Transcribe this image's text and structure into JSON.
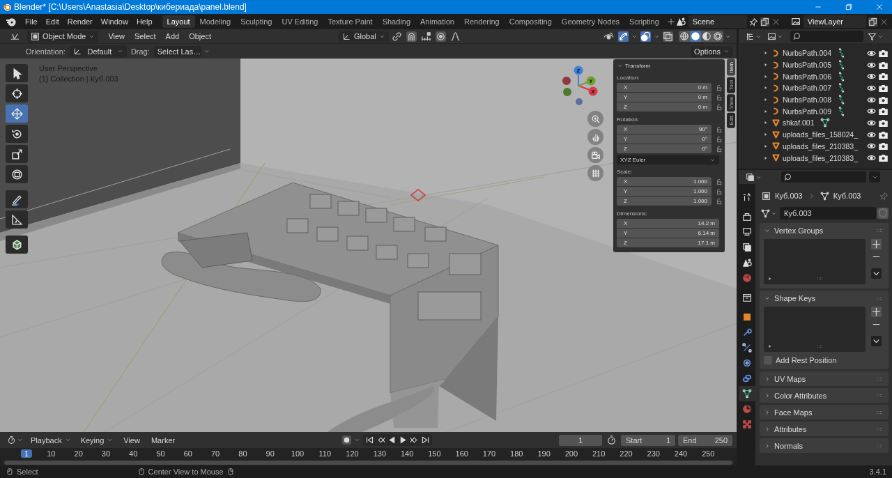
{
  "window": {
    "title": "Blender* [C:\\Users\\Anastasia\\Desktop\\кибериада\\panel.blend]"
  },
  "menu": [
    "File",
    "Edit",
    "Render",
    "Window",
    "Help"
  ],
  "workspaces": [
    {
      "label": "Layout",
      "selected": true
    },
    {
      "label": "Modeling",
      "selected": false
    },
    {
      "label": "Sculpting",
      "selected": false
    },
    {
      "label": "UV Editing",
      "selected": false
    },
    {
      "label": "Texture Paint",
      "selected": false
    },
    {
      "label": "Shading",
      "selected": false
    },
    {
      "label": "Animation",
      "selected": false
    },
    {
      "label": "Rendering",
      "selected": false
    },
    {
      "label": "Compositing",
      "selected": false
    },
    {
      "label": "Geometry Nodes",
      "selected": false
    },
    {
      "label": "Scripting",
      "selected": false
    }
  ],
  "scene": "Scene",
  "view_layer": "ViewLayer",
  "viewport_header": {
    "mode": "Object Mode",
    "menus": [
      "View",
      "Select",
      "Add",
      "Object"
    ],
    "orientation": "Global",
    "gizmos_on": true,
    "overlays_on": true,
    "shading_modes": [
      {
        "kind": "wireframe",
        "selected": false
      },
      {
        "kind": "solid",
        "selected": true
      },
      {
        "kind": "material",
        "selected": false
      },
      {
        "kind": "rendered",
        "selected": false
      }
    ]
  },
  "tool_settings": {
    "orientation_label": "Orientation:",
    "orientation": "Default",
    "drag_label": "Drag:",
    "drag": "Select Las…",
    "options": "Options"
  },
  "viewport": {
    "view_name": "User Perspective",
    "collection": "(1) Collection | Куб.003",
    "axes": [
      "Z",
      "Y",
      "X"
    ]
  },
  "toolbar": [
    {
      "kind": "select",
      "selected": false
    },
    {
      "kind": "cursor",
      "selected": false
    },
    {
      "kind": "move",
      "selected": true
    },
    {
      "kind": "rotate",
      "selected": false
    },
    {
      "kind": "scale",
      "selected": false
    },
    {
      "kind": "transform",
      "selected": false
    },
    {
      "kind": "annotate",
      "selected": false
    },
    {
      "kind": "measure",
      "selected": false
    },
    {
      "kind": "add_cube",
      "selected": false
    }
  ],
  "transform_panel": {
    "title": "Transform",
    "groups": [
      {
        "label": "Location:",
        "locks": true,
        "fields": [
          {
            "axis": "X",
            "value": "0 m"
          },
          {
            "axis": "Y",
            "value": "0 m"
          },
          {
            "axis": "Z",
            "value": "0 m"
          }
        ]
      },
      {
        "label": "Rotation:",
        "locks": true,
        "mode": "XYZ Euler",
        "fields": [
          {
            "axis": "X",
            "value": "90°"
          },
          {
            "axis": "Y",
            "value": "0°"
          },
          {
            "axis": "Z",
            "value": "0°"
          }
        ]
      },
      {
        "label": "Scale:",
        "locks": true,
        "fields": [
          {
            "axis": "X",
            "value": "1.000"
          },
          {
            "axis": "Y",
            "value": "1.000"
          },
          {
            "axis": "Z",
            "value": "1.000"
          }
        ]
      },
      {
        "label": "Dimensions:",
        "locks": false,
        "fields": [
          {
            "axis": "X",
            "value": "14.2 m"
          },
          {
            "axis": "Y",
            "value": "6.14 m"
          },
          {
            "axis": "Z",
            "value": "17.1 m"
          }
        ]
      }
    ]
  },
  "sidebar_tabs": [
    {
      "label": "Item",
      "selected": true
    },
    {
      "label": "Tool",
      "selected": false
    },
    {
      "label": "View",
      "selected": false
    },
    {
      "label": "Edit",
      "selected": false
    }
  ],
  "outliner": {
    "rows": [
      {
        "name": "NurbsPath.004",
        "kind": "curve",
        "data_icon": true
      },
      {
        "name": "NurbsPath.005",
        "kind": "curve",
        "data_icon": true
      },
      {
        "name": "NurbsPath.006",
        "kind": "curve",
        "data_icon": true
      },
      {
        "name": "NurbsPath.007",
        "kind": "curve",
        "data_icon": true
      },
      {
        "name": "NurbsPath.008",
        "kind": "curve",
        "data_icon": true
      },
      {
        "name": "NurbsPath.009",
        "kind": "curve",
        "data_icon": true
      },
      {
        "name": "shkaf.001",
        "kind": "mesh",
        "data_icon": true
      },
      {
        "name": "uploads_files_158024_",
        "kind": "mesh"
      },
      {
        "name": "uploads_files_210383_",
        "kind": "mesh"
      },
      {
        "name": "uploads_files_210383_",
        "kind": "mesh"
      }
    ]
  },
  "properties": {
    "breadcrumb": [
      "Куб.003",
      "Куб.003"
    ],
    "datablock": "Куб.003",
    "tabs": [
      {
        "kind": "tool",
        "selected": false
      },
      {
        "kind": "render",
        "selected": false
      },
      {
        "kind": "output",
        "selected": false
      },
      {
        "kind": "view_layer",
        "selected": false
      },
      {
        "kind": "scene",
        "selected": false
      },
      {
        "kind": "world",
        "selected": false
      },
      {
        "kind": "collection",
        "selected": false
      },
      {
        "kind": "object",
        "selected": false
      },
      {
        "kind": "modifiers",
        "selected": false
      },
      {
        "kind": "particles",
        "selected": false
      },
      {
        "kind": "physics",
        "selected": false
      },
      {
        "kind": "constraints",
        "selected": false
      },
      {
        "kind": "data",
        "selected": true
      },
      {
        "kind": "material",
        "selected": false
      },
      {
        "kind": "texture",
        "selected": false
      }
    ],
    "panels": [
      {
        "title": "Vertex Groups",
        "expanded": true,
        "kind": "list"
      },
      {
        "title": "Shape Keys",
        "expanded": true,
        "kind": "list",
        "checkbox": {
          "label": "Add Rest Position",
          "checked": false
        }
      },
      {
        "title": "UV Maps",
        "expanded": false
      },
      {
        "title": "Color Attributes",
        "expanded": false
      },
      {
        "title": "Face Maps",
        "expanded": false
      },
      {
        "title": "Attributes",
        "expanded": false
      },
      {
        "title": "Normals",
        "expanded": false
      }
    ]
  },
  "timeline": {
    "menus": [
      "Playback",
      "Keying",
      "View",
      "Marker"
    ],
    "current_frame": "1",
    "start_label": "Start",
    "start": "1",
    "end_label": "End",
    "end": "250",
    "ruler": [
      "1",
      "10",
      "20",
      "30",
      "40",
      "50",
      "60",
      "70",
      "80",
      "90",
      "100",
      "110",
      "120",
      "130",
      "140",
      "150",
      "160",
      "170",
      "180",
      "190",
      "200",
      "210",
      "220",
      "230",
      "240",
      "250"
    ]
  },
  "status_bar": {
    "hints": [
      "Select",
      "Center View to Mouse"
    ],
    "version": "3.4.1"
  }
}
